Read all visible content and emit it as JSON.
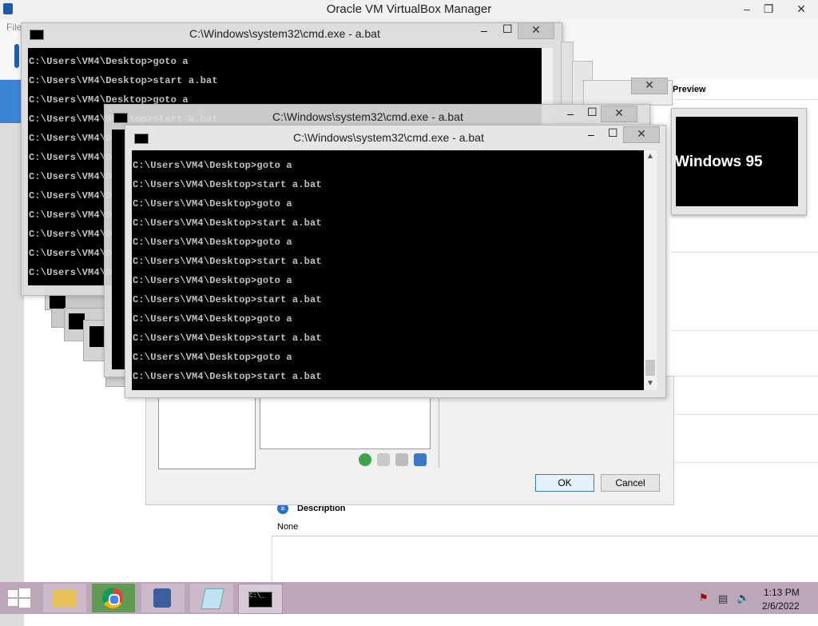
{
  "vbox": {
    "title": "Oracle VM VirtualBox Manager",
    "menu_file": "File",
    "min": "–",
    "max": "❐",
    "close": "✕",
    "preview_label": "Preview",
    "preview_vm": "Windows 95",
    "description_title": "Description",
    "description_value": "None"
  },
  "dialog": {
    "ok": "OK",
    "cancel": "Cancel"
  },
  "cmd": {
    "title": "C:\\Windows\\system32\\cmd.exe - a.bat",
    "icon_text": "C:\\_",
    "close": "✕",
    "max": "☐",
    "min": "–",
    "lines": [
      "C:\\Users\\VM4\\Desktop>goto a",
      "C:\\Users\\VM4\\Desktop>start a.bat",
      "C:\\Users\\VM4\\Desktop>goto a",
      "C:\\Users\\VM4\\Desktop>start a.bat",
      "C:\\Users\\VM4\\Desktop>goto a",
      "C:\\Users\\VM4\\Desktop>start a.bat",
      "C:\\Users\\VM4\\Desktop>goto a",
      "C:\\Users\\VM4\\Desktop>start a.bat",
      "C:\\Users\\VM4\\Desktop>goto a",
      "C:\\Users\\VM4\\Desktop>start a.bat",
      "C:\\Users\\VM4\\Desktop>goto a",
      "C:\\Users\\VM4\\Desktop>start a.bat"
    ]
  },
  "taskbar": {
    "time": "1:13 PM",
    "date": "2/6/2022"
  },
  "colors": {
    "taskbar": "#bba7b8",
    "console_bg": "#000000",
    "console_fg": "#c0c0c0"
  }
}
